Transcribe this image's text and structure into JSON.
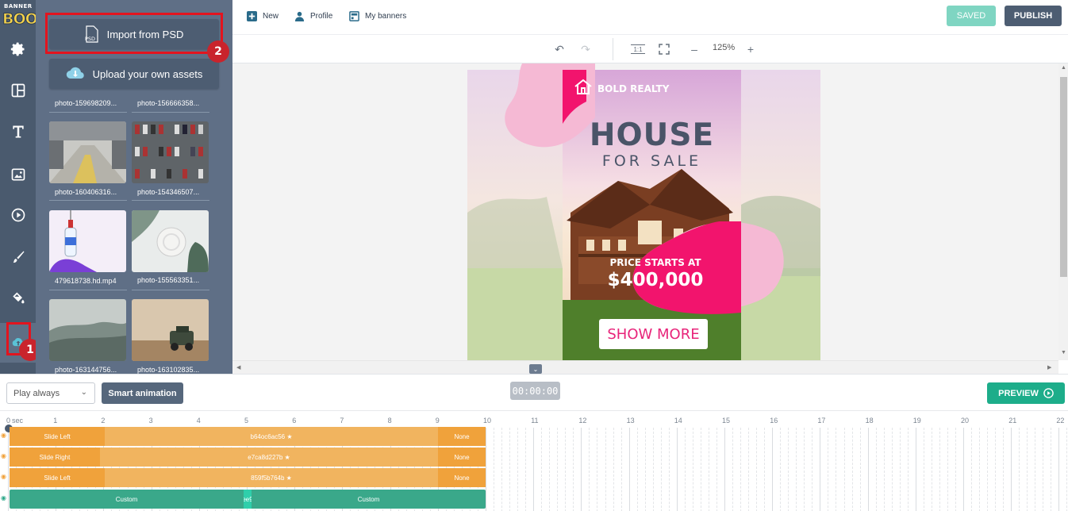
{
  "app": {
    "logo_line1": "BANNER",
    "logo_line2": "BOO"
  },
  "markers": {
    "first": "1",
    "second": "2"
  },
  "panel": {
    "import_label": "Import from PSD",
    "import_badge": "PSD",
    "upload_label": "Upload your own assets",
    "assets": [
      "photo-159698209...",
      "photo-156666358...",
      "photo-160406316...",
      "photo-154346507...",
      "479618738.hd.mp4",
      "photo-155563351...",
      "photo-163144756...",
      "photo-163102835..."
    ]
  },
  "topbar": {
    "new_label": "New",
    "profile_label": "Profile",
    "banners_label": "My banners",
    "saved_label": "SAVED",
    "publish_label": "PUBLISH"
  },
  "canvas_toolbar": {
    "fit_label": "1:1",
    "zoom": "125%"
  },
  "banner": {
    "brand": "BOLD REALTY",
    "headline": "HOUSE",
    "subheadline": "FOR SALE",
    "price_label": "PRICE STARTS AT",
    "price": "$400,000",
    "cta": "SHOW MORE",
    "colors": {
      "accent": "#f2146d",
      "headline": "#4a5468",
      "blob": "#f5b9d4"
    }
  },
  "timeline": {
    "play_mode": "Play always",
    "smart_label": "Smart animation",
    "timer": "00:00:00",
    "preview_label": "PREVIEW",
    "ruler_unit": "sec",
    "ruler": [
      "0",
      "1",
      "2",
      "3",
      "4",
      "5",
      "6",
      "7",
      "8",
      "9",
      "10",
      "11",
      "12",
      "13",
      "14",
      "15",
      "16",
      "17",
      "18",
      "19",
      "20",
      "21",
      "22"
    ],
    "tracks": [
      {
        "in": "Slide Left",
        "id": "b64oc6ac56",
        "out": "None"
      },
      {
        "in": "Slide Right",
        "id": "e7ca8d227b",
        "out": "None"
      },
      {
        "in": "Slide Left",
        "id": "859f5b764b",
        "out": "None"
      },
      {
        "in": "Custom",
        "id": "ee9",
        "out": "Custom"
      }
    ]
  }
}
